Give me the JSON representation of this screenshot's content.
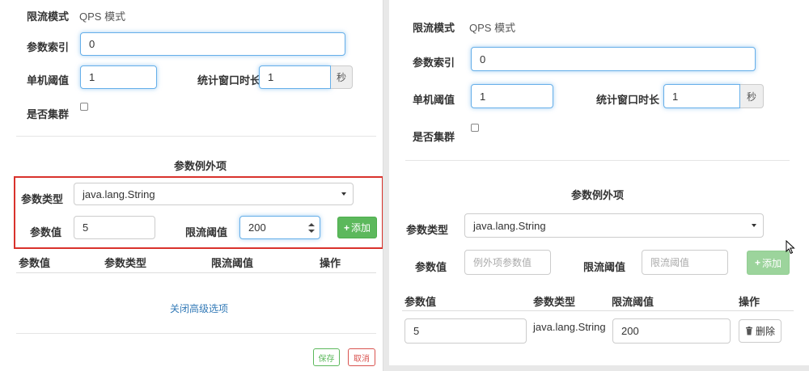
{
  "left": {
    "limit_mode_label": "限流模式",
    "limit_mode_value": "QPS 模式",
    "param_index_label": "参数索引",
    "param_index_value": "0",
    "threshold_label": "单机阈值",
    "threshold_value": "1",
    "window_label": "统计窗口时长",
    "window_value": "1",
    "window_unit": "秒",
    "cluster_label": "是否集群",
    "exception_title": "参数例外项",
    "param_type_label": "参数类型",
    "param_type_value": "java.lang.String",
    "param_value_label": "参数值",
    "param_value_value": "5",
    "limit_threshold_label": "限流阈值",
    "limit_threshold_value": "200",
    "add_button": "添加",
    "table_headers": [
      "参数值",
      "参数类型",
      "限流阈值",
      "操作"
    ],
    "close_advanced": "关闭高级选项",
    "save_button": "保存",
    "cancel_button": "取消"
  },
  "right": {
    "limit_mode_label": "限流模式",
    "limit_mode_value": "QPS 模式",
    "param_index_label": "参数索引",
    "param_index_value": "0",
    "threshold_label": "单机阈值",
    "threshold_value": "1",
    "window_label": "统计窗口时长",
    "window_value": "1",
    "window_unit": "秒",
    "cluster_label": "是否集群",
    "exception_title": "参数例外项",
    "param_type_label": "参数类型",
    "param_type_value": "java.lang.String",
    "param_value_label": "参数值",
    "param_value_placeholder": "例外项参数值",
    "limit_threshold_label": "限流阈值",
    "limit_threshold_placeholder": "限流阈值",
    "add_button": "添加",
    "table_headers": [
      "参数值",
      "参数类型",
      "限流阈值",
      "操作"
    ],
    "rows": [
      {
        "param_value": "5",
        "param_type": "java.lang.String",
        "threshold": "200",
        "delete_label": "删除"
      }
    ]
  },
  "colors": {
    "primary_link": "#337ab7",
    "success": "#5cb85c",
    "danger": "#d9534f",
    "highlight_box": "#d9322c"
  }
}
